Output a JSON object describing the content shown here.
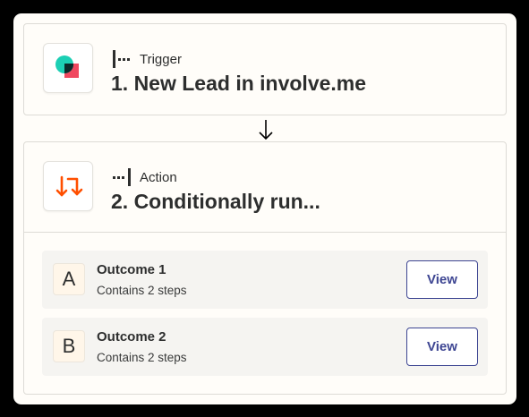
{
  "trigger": {
    "type_label": "Trigger",
    "title": "1. New Lead in involve.me",
    "app_icon": "involve-me-logo-icon",
    "type_icon": "trigger-step-icon"
  },
  "action": {
    "type_label": "Action",
    "title": "2. Conditionally run...",
    "app_icon": "paths-icon",
    "type_icon": "action-step-icon",
    "outcomes": [
      {
        "letter": "A",
        "title": "Outcome 1",
        "subtitle": "Contains 2 steps",
        "button": "View"
      },
      {
        "letter": "B",
        "title": "Outcome 2",
        "subtitle": "Contains 2 steps",
        "button": "View"
      }
    ]
  },
  "colors": {
    "accent": "#3d4592",
    "paths_orange": "#ff4f00",
    "logo_teal": "#1ccfb4",
    "logo_red": "#f0485f",
    "background": "#fffdf9"
  }
}
